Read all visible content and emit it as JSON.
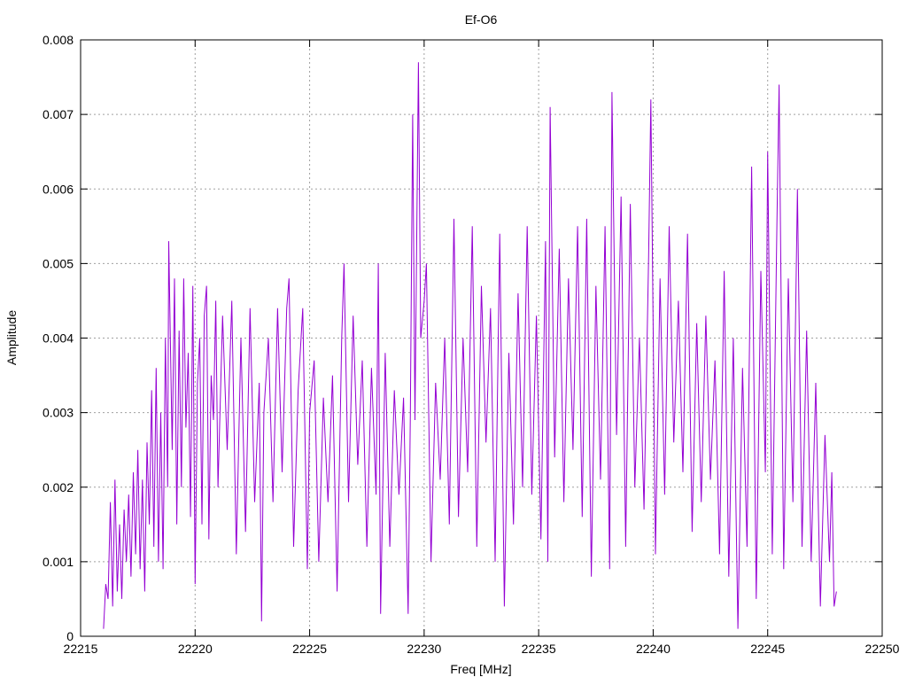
{
  "chart_data": {
    "type": "line",
    "title": "Ef-O6",
    "xlabel": "Freq [MHz]",
    "ylabel": "Amplitude",
    "xlim": [
      22215,
      22250
    ],
    "ylim": [
      0,
      0.008
    ],
    "x_ticks": [
      22215,
      22220,
      22225,
      22230,
      22235,
      22240,
      22245,
      22250
    ],
    "x_tick_labels": [
      "22215",
      "22220",
      "22225",
      "22230",
      "22235",
      "22240",
      "22245",
      "22250"
    ],
    "y_ticks": [
      0,
      0.001,
      0.002,
      0.003,
      0.004,
      0.005,
      0.006,
      0.007,
      0.008
    ],
    "y_tick_labels": [
      "0",
      "0.001",
      "0.002",
      "0.003",
      "0.004",
      "0.005",
      "0.006",
      "0.007",
      "0.008"
    ],
    "grid": true,
    "legend": "none",
    "series": [
      {
        "color": "#9400D3",
        "points": [
          [
            22216.0,
            0.0001
          ],
          [
            22216.1,
            0.0007
          ],
          [
            22216.2,
            0.0005
          ],
          [
            22216.3,
            0.0018
          ],
          [
            22216.4,
            0.0004
          ],
          [
            22216.5,
            0.0021
          ],
          [
            22216.6,
            0.0006
          ],
          [
            22216.7,
            0.0015
          ],
          [
            22216.8,
            0.0005
          ],
          [
            22216.9,
            0.0017
          ],
          [
            22217.0,
            0.001
          ],
          [
            22217.1,
            0.0019
          ],
          [
            22217.2,
            0.0008
          ],
          [
            22217.3,
            0.0022
          ],
          [
            22217.4,
            0.0011
          ],
          [
            22217.5,
            0.0025
          ],
          [
            22217.6,
            0.0009
          ],
          [
            22217.7,
            0.0021
          ],
          [
            22217.8,
            0.0006
          ],
          [
            22217.9,
            0.0026
          ],
          [
            22218.0,
            0.0015
          ],
          [
            22218.1,
            0.0033
          ],
          [
            22218.2,
            0.0012
          ],
          [
            22218.3,
            0.0036
          ],
          [
            22218.4,
            0.001
          ],
          [
            22218.5,
            0.003
          ],
          [
            22218.6,
            0.0009
          ],
          [
            22218.7,
            0.004
          ],
          [
            22218.8,
            0.002
          ],
          [
            22218.85,
            0.0053
          ],
          [
            22219.0,
            0.0025
          ],
          [
            22219.1,
            0.0048
          ],
          [
            22219.2,
            0.0015
          ],
          [
            22219.3,
            0.0041
          ],
          [
            22219.4,
            0.002
          ],
          [
            22219.5,
            0.0048
          ],
          [
            22219.6,
            0.0028
          ],
          [
            22219.7,
            0.0038
          ],
          [
            22219.8,
            0.0016
          ],
          [
            22219.9,
            0.0047
          ],
          [
            22220.0,
            0.0007
          ],
          [
            22220.1,
            0.0034
          ],
          [
            22220.2,
            0.004
          ],
          [
            22220.3,
            0.0015
          ],
          [
            22220.4,
            0.0043
          ],
          [
            22220.5,
            0.0047
          ],
          [
            22220.6,
            0.0013
          ],
          [
            22220.7,
            0.0035
          ],
          [
            22220.8,
            0.0029
          ],
          [
            22220.9,
            0.0045
          ],
          [
            22221.0,
            0.002
          ],
          [
            22221.2,
            0.0043
          ],
          [
            22221.4,
            0.0025
          ],
          [
            22221.6,
            0.0045
          ],
          [
            22221.8,
            0.0011
          ],
          [
            22222.0,
            0.004
          ],
          [
            22222.2,
            0.0014
          ],
          [
            22222.4,
            0.0044
          ],
          [
            22222.6,
            0.0018
          ],
          [
            22222.8,
            0.0034
          ],
          [
            22222.9,
            0.0002
          ],
          [
            22223.0,
            0.003
          ],
          [
            22223.2,
            0.004
          ],
          [
            22223.4,
            0.0018
          ],
          [
            22223.6,
            0.0044
          ],
          [
            22223.8,
            0.0022
          ],
          [
            22224.0,
            0.0044
          ],
          [
            22224.1,
            0.0048
          ],
          [
            22224.3,
            0.0012
          ],
          [
            22224.5,
            0.0033
          ],
          [
            22224.7,
            0.0044
          ],
          [
            22224.9,
            0.0009
          ],
          [
            22225.0,
            0.003
          ],
          [
            22225.2,
            0.0037
          ],
          [
            22225.4,
            0.001
          ],
          [
            22225.6,
            0.0032
          ],
          [
            22225.8,
            0.0018
          ],
          [
            22226.0,
            0.0035
          ],
          [
            22226.2,
            0.0006
          ],
          [
            22226.4,
            0.004
          ],
          [
            22226.5,
            0.005
          ],
          [
            22226.7,
            0.0018
          ],
          [
            22226.9,
            0.0043
          ],
          [
            22227.1,
            0.0023
          ],
          [
            22227.3,
            0.0037
          ],
          [
            22227.5,
            0.0012
          ],
          [
            22227.7,
            0.0036
          ],
          [
            22227.9,
            0.0019
          ],
          [
            22228.0,
            0.005
          ],
          [
            22228.1,
            0.0003
          ],
          [
            22228.3,
            0.0038
          ],
          [
            22228.5,
            0.0012
          ],
          [
            22228.7,
            0.0033
          ],
          [
            22228.9,
            0.0019
          ],
          [
            22229.1,
            0.0032
          ],
          [
            22229.3,
            0.0003
          ],
          [
            22229.4,
            0.003
          ],
          [
            22229.5,
            0.007
          ],
          [
            22229.6,
            0.0029
          ],
          [
            22229.75,
            0.0077
          ],
          [
            22229.85,
            0.004
          ],
          [
            22230.0,
            0.0045
          ],
          [
            22230.1,
            0.005
          ],
          [
            22230.3,
            0.001
          ],
          [
            22230.5,
            0.0034
          ],
          [
            22230.7,
            0.0021
          ],
          [
            22230.9,
            0.004
          ],
          [
            22231.1,
            0.0015
          ],
          [
            22231.3,
            0.0056
          ],
          [
            22231.5,
            0.0016
          ],
          [
            22231.7,
            0.004
          ],
          [
            22231.9,
            0.0022
          ],
          [
            22232.1,
            0.0055
          ],
          [
            22232.3,
            0.0012
          ],
          [
            22232.5,
            0.0047
          ],
          [
            22232.7,
            0.0026
          ],
          [
            22232.9,
            0.0044
          ],
          [
            22233.1,
            0.001
          ],
          [
            22233.3,
            0.0054
          ],
          [
            22233.5,
            0.0004
          ],
          [
            22233.7,
            0.0038
          ],
          [
            22233.9,
            0.0015
          ],
          [
            22234.1,
            0.0046
          ],
          [
            22234.3,
            0.002
          ],
          [
            22234.5,
            0.0055
          ],
          [
            22234.7,
            0.0019
          ],
          [
            22234.9,
            0.0043
          ],
          [
            22235.1,
            0.0013
          ],
          [
            22235.3,
            0.0053
          ],
          [
            22235.4,
            0.001
          ],
          [
            22235.5,
            0.0071
          ],
          [
            22235.7,
            0.0024
          ],
          [
            22235.9,
            0.0052
          ],
          [
            22236.1,
            0.0018
          ],
          [
            22236.3,
            0.0048
          ],
          [
            22236.5,
            0.0025
          ],
          [
            22236.7,
            0.0055
          ],
          [
            22236.9,
            0.0016
          ],
          [
            22237.1,
            0.0056
          ],
          [
            22237.3,
            0.0008
          ],
          [
            22237.5,
            0.0047
          ],
          [
            22237.7,
            0.0021
          ],
          [
            22237.9,
            0.0055
          ],
          [
            22238.1,
            0.0009
          ],
          [
            22238.2,
            0.0073
          ],
          [
            22238.4,
            0.0027
          ],
          [
            22238.6,
            0.0059
          ],
          [
            22238.8,
            0.0012
          ],
          [
            22239.0,
            0.0058
          ],
          [
            22239.2,
            0.002
          ],
          [
            22239.4,
            0.004
          ],
          [
            22239.6,
            0.0017
          ],
          [
            22239.8,
            0.0051
          ],
          [
            22239.9,
            0.0072
          ],
          [
            22240.1,
            0.0011
          ],
          [
            22240.3,
            0.0048
          ],
          [
            22240.5,
            0.0019
          ],
          [
            22240.7,
            0.0055
          ],
          [
            22240.9,
            0.0026
          ],
          [
            22241.1,
            0.0045
          ],
          [
            22241.3,
            0.0022
          ],
          [
            22241.5,
            0.0054
          ],
          [
            22241.7,
            0.0014
          ],
          [
            22241.9,
            0.0042
          ],
          [
            22242.1,
            0.0018
          ],
          [
            22242.3,
            0.0043
          ],
          [
            22242.5,
            0.0021
          ],
          [
            22242.7,
            0.0037
          ],
          [
            22242.9,
            0.0011
          ],
          [
            22243.1,
            0.0049
          ],
          [
            22243.3,
            0.0008
          ],
          [
            22243.5,
            0.004
          ],
          [
            22243.7,
            0.0001
          ],
          [
            22243.9,
            0.0036
          ],
          [
            22244.1,
            0.0012
          ],
          [
            22244.3,
            0.0063
          ],
          [
            22244.5,
            0.0005
          ],
          [
            22244.7,
            0.0049
          ],
          [
            22244.9,
            0.0022
          ],
          [
            22245.0,
            0.0065
          ],
          [
            22245.2,
            0.0011
          ],
          [
            22245.4,
            0.0055
          ],
          [
            22245.5,
            0.0074
          ],
          [
            22245.7,
            0.0009
          ],
          [
            22245.9,
            0.0048
          ],
          [
            22246.1,
            0.0018
          ],
          [
            22246.3,
            0.006
          ],
          [
            22246.5,
            0.0012
          ],
          [
            22246.7,
            0.0041
          ],
          [
            22246.9,
            0.001
          ],
          [
            22247.1,
            0.0034
          ],
          [
            22247.3,
            0.0004
          ],
          [
            22247.5,
            0.0027
          ],
          [
            22247.7,
            0.001
          ],
          [
            22247.8,
            0.0022
          ],
          [
            22247.9,
            0.0004
          ],
          [
            22248.0,
            0.0006
          ]
        ]
      }
    ]
  }
}
